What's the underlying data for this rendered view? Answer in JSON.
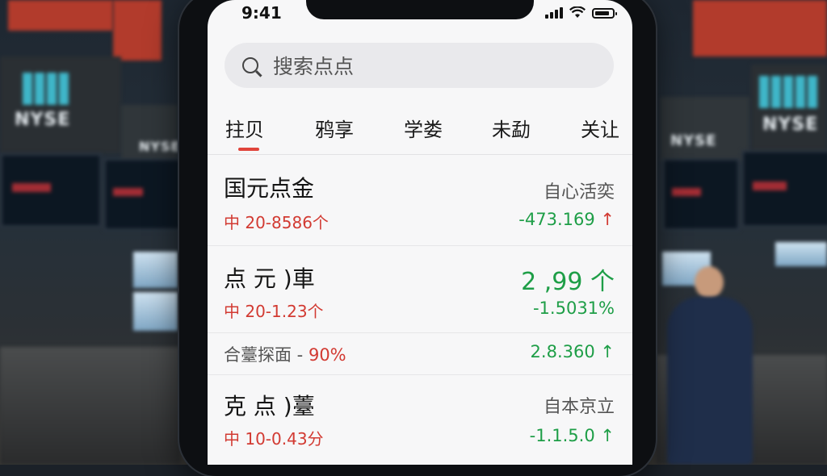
{
  "status": {
    "time": "9:41"
  },
  "search": {
    "placeholder": "搜索点点"
  },
  "tabs": [
    {
      "label": "拄贝",
      "active": true
    },
    {
      "label": "鸦享"
    },
    {
      "label": "学娄"
    },
    {
      "label": "未勐"
    },
    {
      "label": "关让"
    }
  ],
  "rows": [
    {
      "name": "国元点金",
      "sub_prefix": "中",
      "sub_value": "20-8586个",
      "right_label": "自心活奕",
      "change": "-473.169",
      "change_arrow": "↑"
    },
    {
      "name": "点 元 )車",
      "sub_prefix": "中",
      "sub_value": "20-1.23个",
      "price": "2 ,99",
      "price_arrow": "个",
      "change": "-1.5031%"
    },
    {
      "label": "合薹探面 -",
      "label_value": "90%",
      "change": "2.8.360",
      "change_arrow": "↑"
    },
    {
      "name": "克 点 )薹",
      "sub_prefix": "中",
      "sub_value": "10-0.43分",
      "right_label": "自本京立",
      "change": "-1.1.5.0",
      "change_arrow": "↑"
    }
  ],
  "background": {
    "sign_left": "NYSE",
    "sign_left_2": "NYSE",
    "sign_right": "NYSE",
    "sign_right_2": "NYSE"
  },
  "colors": {
    "red": "#d23a32",
    "green": "#1e9e47",
    "tab_accent": "#e0443b"
  }
}
